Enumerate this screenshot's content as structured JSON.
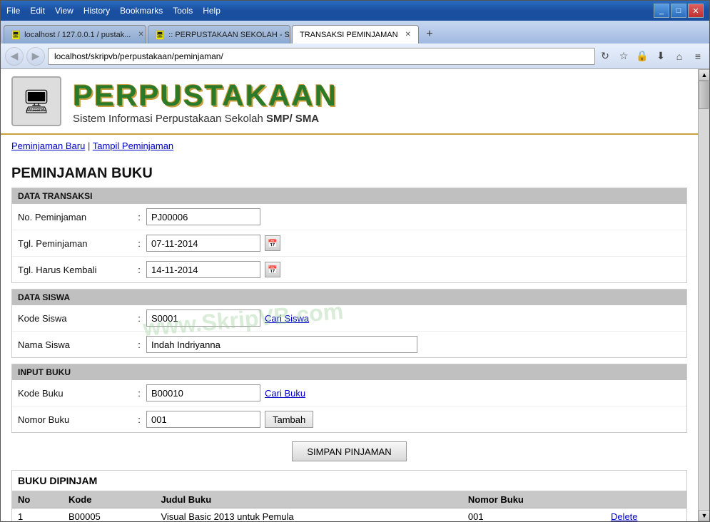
{
  "titlebar": {
    "menu": [
      "File",
      "Edit",
      "View",
      "History",
      "Bookmarks",
      "Tools",
      "Help"
    ],
    "controls": [
      "_",
      "□",
      "✕"
    ]
  },
  "tabs": [
    {
      "id": "tab1",
      "label": "localhost / 127.0.0.1 / pustak...",
      "active": false,
      "closable": true
    },
    {
      "id": "tab2",
      "label": ":: PERPUSTAKAAN SEKOLAH - Sist...",
      "active": false,
      "closable": true
    },
    {
      "id": "tab3",
      "label": "TRANSAKSI PEMINJAMAN",
      "active": true,
      "closable": true
    }
  ],
  "navbar": {
    "address": "localhost/skripvb/perpustakaan/peminjaman/"
  },
  "header": {
    "title": "PERPUSTAKAAN",
    "subtitle_plain": "Sistem Informasi Perpustakaan Sekolah ",
    "subtitle_bold": "SMP/ SMA"
  },
  "navlinks": {
    "link1": "Peminjaman Baru",
    "separator": " | ",
    "link2": "Tampil Peminjaman"
  },
  "page_title": "PEMINJAMAN BUKU",
  "section_transaksi": {
    "header": "DATA TRANSAKSI",
    "fields": [
      {
        "label": "No. Peminjaman",
        "value": "PJ00006",
        "type": "input_medium"
      },
      {
        "label": "Tgl. Peminjaman",
        "value": "07-11-2014",
        "type": "date"
      },
      {
        "label": "Tgl. Harus Kembali",
        "value": "14-11-2014",
        "type": "date"
      }
    ]
  },
  "section_siswa": {
    "header": "DATA SISWA",
    "fields": [
      {
        "label": "Kode Siswa",
        "value": "S0001",
        "type": "input_with_link",
        "link": "Cari Siswa"
      },
      {
        "label": "Nama Siswa",
        "value": "Indah Indriyanna",
        "type": "input_wide"
      }
    ]
  },
  "section_buku": {
    "header": "INPUT BUKU",
    "fields": [
      {
        "label": "Kode Buku",
        "value": "B00010",
        "type": "input_with_link",
        "link": "Cari Buku"
      },
      {
        "label": "Nomor Buku",
        "value": "001",
        "type": "input_with_btn",
        "btn": "Tambah"
      }
    ]
  },
  "save_btn": "SIMPAN PINJAMAN",
  "table": {
    "title": "BUKU DIPINJAM",
    "columns": [
      "No",
      "Kode",
      "Judul Buku",
      "Nomor Buku",
      ""
    ],
    "rows": [
      {
        "no": "1",
        "kode": "B00005",
        "judul": "Visual Basic 2013 untuk Pemula",
        "nomor": "001",
        "action": "Delete"
      }
    ]
  },
  "watermark": "www.SkripVB.com"
}
